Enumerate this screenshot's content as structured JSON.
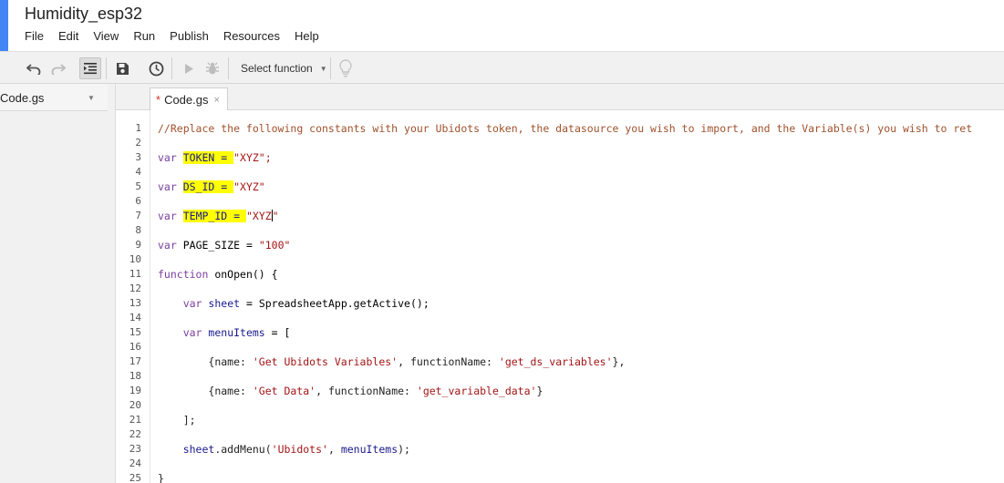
{
  "window": {
    "title": "Humidity_esp32",
    "accent_color": "#4285f4"
  },
  "menubar": [
    "File",
    "Edit",
    "View",
    "Run",
    "Publish",
    "Resources",
    "Help"
  ],
  "toolbar": {
    "undo_icon": "undo-icon",
    "redo_icon": "redo-icon",
    "indent_icon": "indent-icon",
    "save_icon": "save-icon",
    "triggers_icon": "clock-icon",
    "run_icon": "play-icon",
    "debug_icon": "bug-icon",
    "select_function_label": "Select function",
    "bulb_icon": "lightbulb-icon"
  },
  "filepane": {
    "file_name": "Code.gs"
  },
  "tabs": [
    {
      "label": "Code.gs",
      "dirty_marker": "*",
      "close_glyph": "×",
      "active": true
    }
  ],
  "code": {
    "line_numbers": [
      "1",
      "2",
      "3",
      "4",
      "5",
      "6",
      "7",
      "8",
      "9",
      "10",
      "11",
      "12",
      "13",
      "14",
      "15",
      "16",
      "17",
      "18",
      "19",
      "20",
      "21",
      "22",
      "23",
      "24",
      "25"
    ],
    "comment_line1": "//Replace the following constants with your Ubidots token, the datasource you wish to import, and the Variable(s) you wish to ret",
    "kw_var": "var",
    "token_name": "TOKEN = ",
    "token_value": "\"XYZ\";",
    "ds_name": "DS_ID = ",
    "ds_value": "\"XYZ\"",
    "temp_name": "TEMP_ID = ",
    "temp_value": "\"XYZ",
    "temp_close": "\"",
    "page_size_decl": "PAGE_SIZE = ",
    "page_size_value": "\"100\"",
    "kw_function": "function",
    "onopen_sig": "onOpen() {",
    "sheet_decl": "sheet",
    "sheet_rhs": " = SpreadsheetApp.getActive();",
    "menuitems_decl": "menuItems",
    "menuitems_rhs": " = [",
    "item1_a": "{name: ",
    "item1_b": "'Get Ubidots Variables'",
    "item1_c": ", functionName: ",
    "item1_d": "'get_ds_variables'",
    "item1_e": "},",
    "item2_a": "{name: ",
    "item2_b": "'Get Data'",
    "item2_c": ", functionName: ",
    "item2_d": "'get_variable_data'",
    "item2_e": "}",
    "close_bracket": "];",
    "addmenu_a": "sheet",
    "addmenu_b": ".addMenu(",
    "addmenu_c": "'Ubidots'",
    "addmenu_d": ", ",
    "addmenu_e": "menuItems",
    "addmenu_f": ");",
    "close_brace": "}"
  },
  "colors": {
    "highlight": "#ffff00",
    "comment": "#a0522d",
    "keyword": "#7b3f9e",
    "string": "#a31515"
  }
}
